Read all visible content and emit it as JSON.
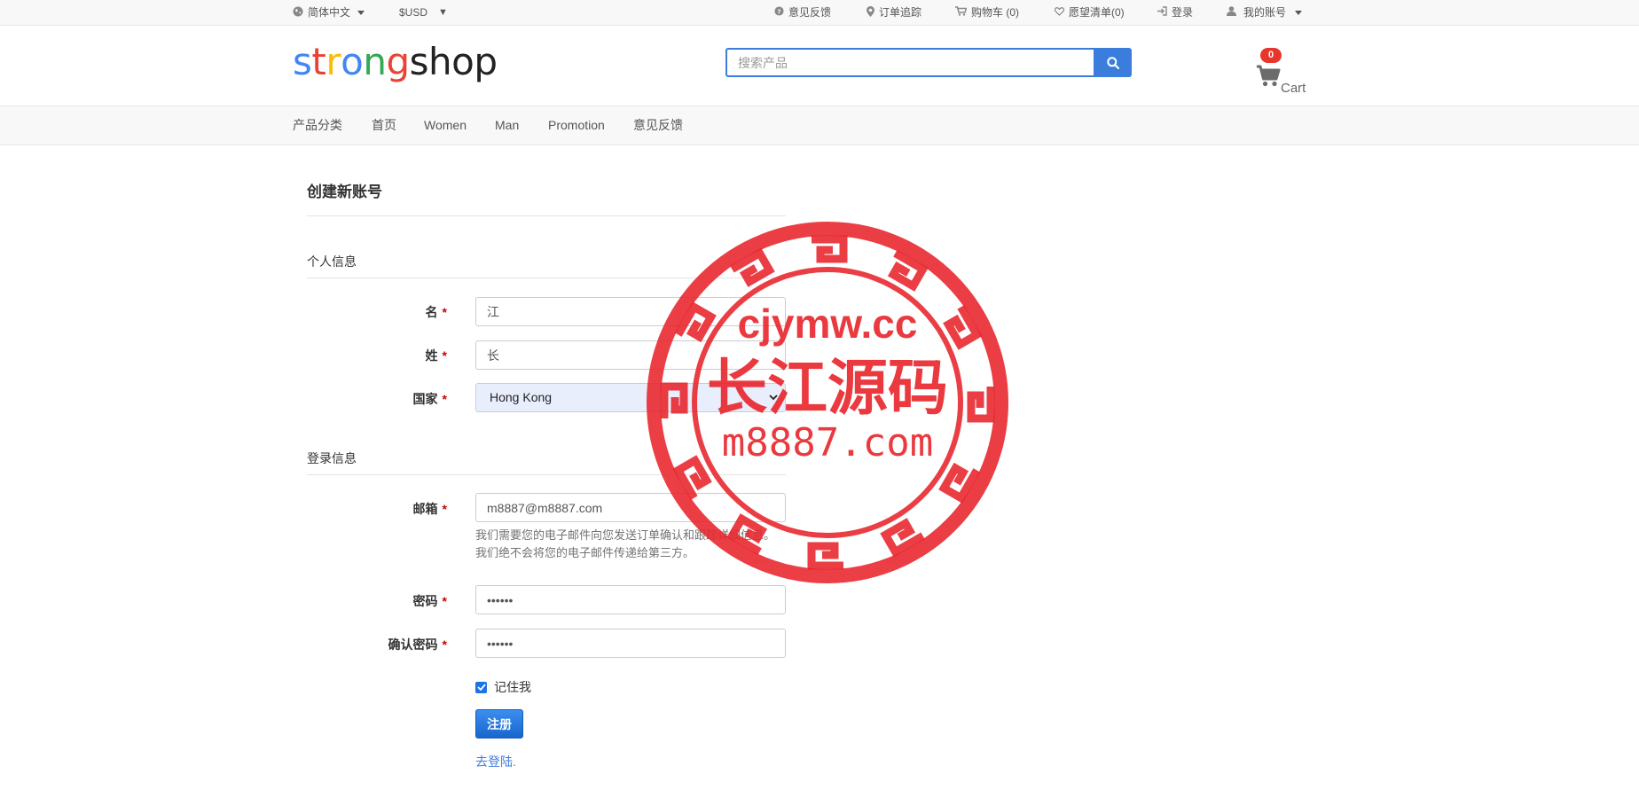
{
  "topbar": {
    "language": "简体中文",
    "currency": "$USD",
    "feedback": "意见反馈",
    "order_tracking": "订单追踪",
    "cart": "购物车 (0)",
    "wishlist": "愿望清单(0)",
    "login": "登录",
    "account": "我的账号"
  },
  "header": {
    "logo_letters": [
      "s",
      "t",
      "r",
      "o",
      "n",
      "g",
      "s",
      "h",
      "o",
      "p"
    ],
    "logo_colors": [
      "#4285f4",
      "#ea4335",
      "#fbbc05",
      "#4285f4",
      "#34a853",
      "#ea4335",
      "#222222",
      "#222222",
      "#222222",
      "#222222"
    ],
    "search_placeholder": "搜索产品",
    "cart_count": "0",
    "cart_label": "Cart"
  },
  "nav": {
    "items": [
      "产品分类",
      "首页",
      "Women",
      "Man",
      "Promotion",
      "意见反馈"
    ]
  },
  "form": {
    "title": "创建新账号",
    "personal_legend": "个人信息",
    "first_name_label": "名",
    "first_name_value": "江",
    "last_name_label": "姓",
    "last_name_value": "长",
    "country_label": "国家",
    "country_value": "Hong Kong",
    "login_legend": "登录信息",
    "email_label": "邮箱",
    "email_value": "m8887@m8887.com",
    "email_help": "我们需要您的电子邮件向您发送订单确认和跟踪详细信息。 我们绝不会将您的电子邮件传递给第三方。",
    "password_label": "密码",
    "password_value": "••••••",
    "confirm_password_label": "确认密码",
    "confirm_password_value": "••••••",
    "required_mark": "*",
    "remember_me": "记住我",
    "remember_checked": true,
    "register_button": "注册",
    "login_link": "去登陆."
  },
  "watermark": {
    "line1": "cjymw.cc",
    "line2": "长江源码",
    "line3": "m8887.com",
    "color": "#e8242b"
  },
  "colors": {
    "accent": "#3b7ddd",
    "badge": "#e8362d"
  }
}
